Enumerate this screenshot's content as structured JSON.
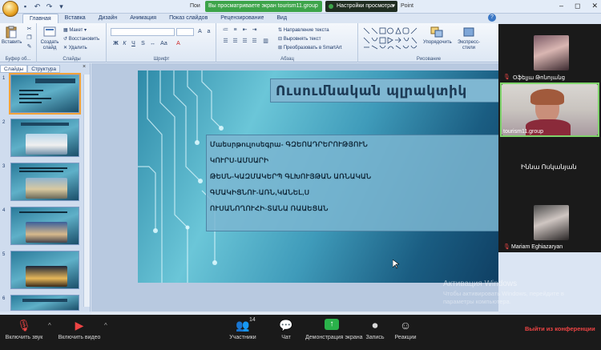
{
  "titlebar": {
    "app_title_fragment": "Пои",
    "app_title_fragment2": "Point",
    "qat_icons": [
      "save-icon",
      "undo-icon",
      "redo-icon",
      "dropdown-icon"
    ]
  },
  "zoom_banner": {
    "viewing_text": "Вы просматриваете экран tourism11.group",
    "view_options_label": "Настройки просмотра"
  },
  "ribbon_tabs": [
    "Главная",
    "Вставка",
    "Дизайн",
    "Анимация",
    "Показ слайдов",
    "Рецензирование",
    "Вид"
  ],
  "ribbon": {
    "paste_label": "Вставить",
    "clipboard_group": "Буфер об...",
    "new_slide_label": "Создать слайд",
    "layout_label": "Макет",
    "reset_label": "Восстановить",
    "delete_label": "Удалить",
    "slides_group": "Слайды",
    "font_group": "Шрифт",
    "text_direction_label": "Направление текста",
    "align_text_label": "Выровнять текст",
    "smartart_label": "Преобразовать в SmartArt",
    "paragraph_group": "Абзац",
    "arrange_label": "Упорядочить",
    "quick_styles_label": "Экспресс-стили",
    "drawing_group": "Рисование"
  },
  "left_pane": {
    "tab_slides": "Слайды",
    "tab_outline": "Структура",
    "close_glyph": "×",
    "slide_numbers": [
      "1",
      "2",
      "3",
      "4",
      "5",
      "6"
    ]
  },
  "slide": {
    "title": "Ուսումնական պլրակտիկ",
    "body_lines": [
      "Մաեսրթուլոսեգրա- ԳԶԵՈԱԴՐԵՐՈՒԹՅՈՒՆ",
      "ԿՈՒՐՍ-ԱՄՍԱՐԻ",
      "ԹԵՍՆ-ԿԱԶՄԱԿԵՐՊ ԳԼԽՈՒՅԹԱՆ ԱՌՆԱԿԱՆ",
      "ԳՄԱԿԻՑՆՈՒ-ԱՌՆ,ԿԱՆԵԼ,Ս",
      "ՈՒՍԱՆՈՂՈՒՀԻ-ՏԱՆԱ ՌԱԱԵՑԱՆ"
    ]
  },
  "watermark": {
    "line1": "Активация Windows",
    "line2": "Чтобы активировать Windows, перейдите в параметры компьютера."
  },
  "participants": [
    {
      "name": "Օֆելյա Թոնոյանց",
      "muted": true
    },
    {
      "name": "tourism11.group",
      "muted": false
    },
    {
      "name": "Իննա Ոսկանյան",
      "muted": false
    },
    {
      "name": "Mariam Eghiazaryan",
      "muted": true
    }
  ],
  "zoom_toolbar": {
    "mic_label": "Включить звук",
    "video_label": "Включить видео",
    "participants_label": "Участники",
    "participants_count": "14",
    "chat_label": "Чат",
    "share_label": "Демонстрация экрана",
    "record_label": "Запись",
    "reactions_label": "Реакции",
    "leave_label": "Выйти из конференции",
    "caret": "^"
  },
  "colors": {
    "zoom_green": "#3da44a",
    "leave_red": "#e44444",
    "slide_teal": "#2e8aa8"
  }
}
